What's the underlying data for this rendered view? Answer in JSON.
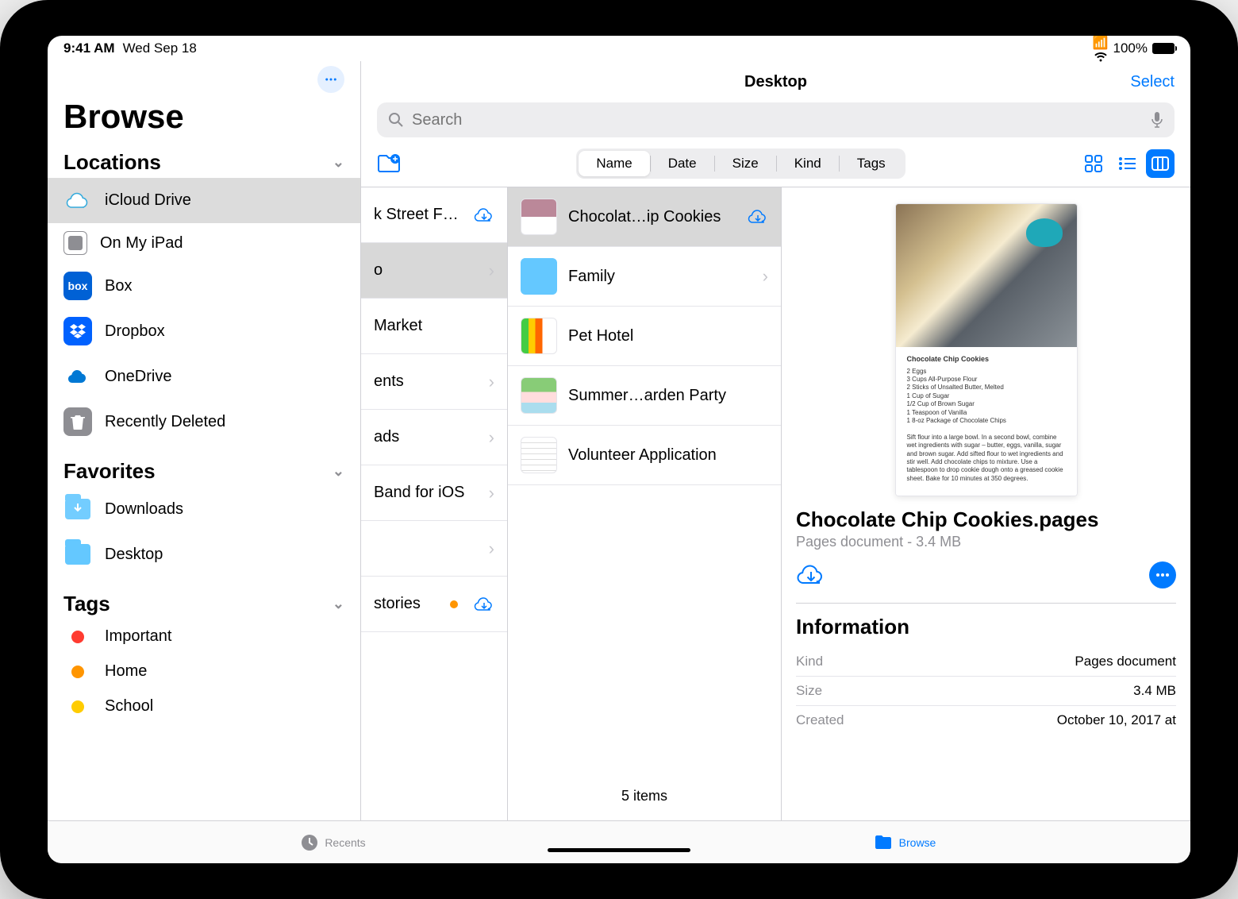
{
  "status": {
    "time": "9:41 AM",
    "date": "Wed Sep 18",
    "battery": "100%"
  },
  "sidebar": {
    "title": "Browse",
    "sections": {
      "locations": {
        "header": "Locations",
        "items": [
          {
            "label": "iCloud Drive"
          },
          {
            "label": "On My iPad"
          },
          {
            "label": "Box"
          },
          {
            "label": "Dropbox"
          },
          {
            "label": "OneDrive"
          },
          {
            "label": "Recently Deleted"
          }
        ]
      },
      "favorites": {
        "header": "Favorites",
        "items": [
          {
            "label": "Downloads"
          },
          {
            "label": "Desktop"
          }
        ]
      },
      "tags": {
        "header": "Tags",
        "items": [
          {
            "label": "Important",
            "color": "#ff3b30"
          },
          {
            "label": "Home",
            "color": "#ff9500"
          },
          {
            "label": "School",
            "color": "#ffcc00"
          }
        ]
      }
    }
  },
  "content": {
    "title": "Desktop",
    "select": "Select",
    "search_placeholder": "Search",
    "sort": {
      "options": [
        "Name",
        "Date",
        "Size",
        "Kind",
        "Tags"
      ],
      "active": "Name"
    }
  },
  "col1": {
    "items": [
      {
        "label": "k Street Food",
        "trail": "cloud"
      },
      {
        "label": "o",
        "trail": "chev",
        "selected": true
      },
      {
        "label": "Market"
      },
      {
        "label": "ents",
        "trail": "chev"
      },
      {
        "label": "ads",
        "trail": "chev"
      },
      {
        "label": "Band for iOS",
        "trail": "chev"
      },
      {
        "label": "",
        "trail": "chev"
      },
      {
        "label": "stories",
        "trail": "cloud",
        "tagged": true
      }
    ]
  },
  "col2": {
    "items": [
      {
        "label": "Chocolat…ip Cookies",
        "trail": "cloud",
        "selected": true,
        "thumb": "doc"
      },
      {
        "label": "Family",
        "trail": "chev",
        "thumb": "folder"
      },
      {
        "label": "Pet Hotel",
        "thumb": "sheet"
      },
      {
        "label": "Summer…arden Party",
        "thumb": "cards"
      },
      {
        "label": "Volunteer Application",
        "thumb": "form"
      }
    ],
    "footer": "5 items"
  },
  "preview": {
    "filename": "Chocolate Chip Cookies.pages",
    "subtitle": "Pages document - 3.4 MB",
    "recipe_title": "Chocolate Chip Cookies",
    "recipe_body": "2 Eggs\n3 Cups All-Purpose Flour\n2 Sticks of Unsalted Butter, Melted\n1 Cup of Sugar\n1/2 Cup of Brown Sugar\n1 Teaspoon of Vanilla\n1 8-oz Package of Chocolate Chips\n\nSift flour into a large bowl. In a second bowl, combine wet ingredients with sugar – butter, eggs, vanilla, sugar and brown sugar. Add sifted flour to wet ingredients and stir well. Add chocolate chips to mixture. Use a tablespoon to drop cookie dough onto a greased cookie sheet. Bake for 10 minutes at 350 degrees.",
    "info_header": "Information",
    "info": [
      {
        "k": "Kind",
        "v": "Pages document"
      },
      {
        "k": "Size",
        "v": "3.4 MB"
      },
      {
        "k": "Created",
        "v": "October 10, 2017 at"
      }
    ]
  },
  "tabs": {
    "recents": "Recents",
    "browse": "Browse"
  }
}
